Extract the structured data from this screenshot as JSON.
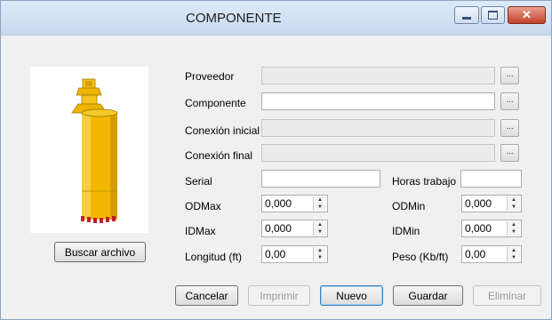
{
  "window": {
    "title": "COMPONENTE"
  },
  "fields": {
    "proveedor": {
      "label": "Proveedor",
      "value": ""
    },
    "componente": {
      "label": "Componente",
      "value": ""
    },
    "conexion_inicial": {
      "label": "Conexión inicial",
      "value": ""
    },
    "conexion_final": {
      "label": "Conexión final",
      "value": ""
    },
    "serial": {
      "label": "Serial",
      "value": ""
    },
    "horas_trabajo": {
      "label": "Horas trabajo",
      "value": ""
    },
    "odmax": {
      "label": "ODMax",
      "value": "0,000"
    },
    "odmin": {
      "label": "ODMin",
      "value": "0,000"
    },
    "idmax": {
      "label": "IDMax",
      "value": "0,000"
    },
    "idmin": {
      "label": "IDMin",
      "value": "0,000"
    },
    "longitud": {
      "label": "Longitud (ft)",
      "value": "0,00"
    },
    "peso": {
      "label": "Peso (Kb/ft)",
      "value": "0,00"
    }
  },
  "ellipsis": "...",
  "buttons": {
    "buscar_archivo": "Buscar archivo",
    "cancelar": "Cancelar",
    "imprimir": "Imprimir",
    "nuevo": "Nuevo",
    "guardar": "Guardar",
    "eliminar": "Eliminar"
  },
  "colors": {
    "component_body": "#f2b800",
    "component_teeth": "#c0202a"
  }
}
